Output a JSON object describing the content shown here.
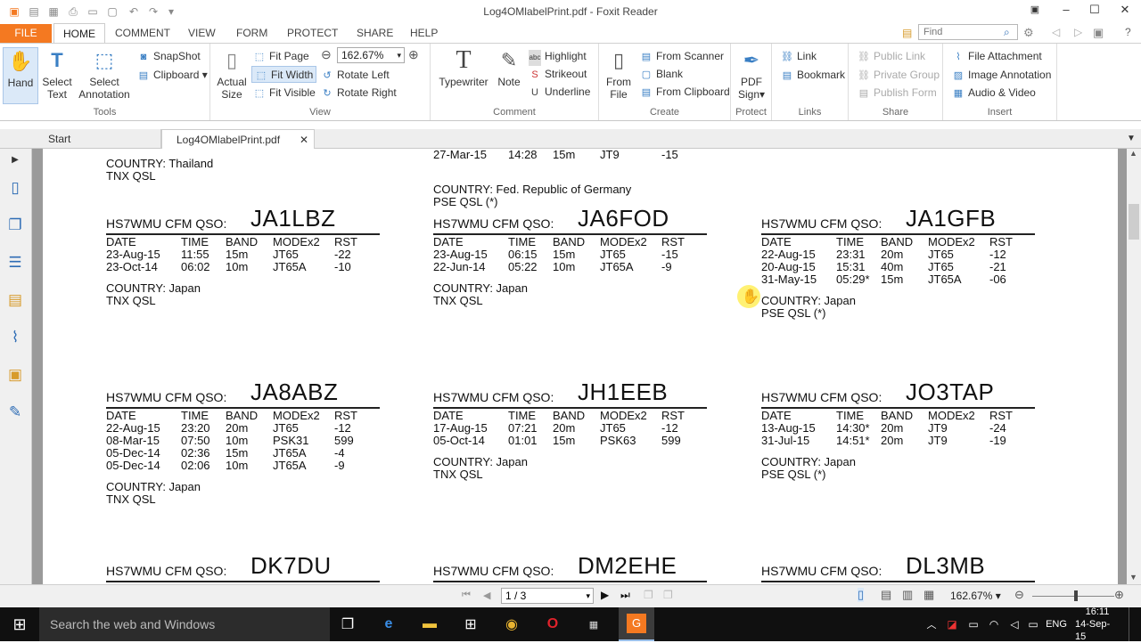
{
  "window": {
    "title": "Log4OMlabelPrint.pdf - Foxit Reader",
    "find_placeholder": "Find",
    "minimize_icon": "minimize-icon",
    "maximize_icon": "maximize-icon",
    "close_icon": "close-icon"
  },
  "menu_tabs": [
    "FILE",
    "HOME",
    "COMMENT",
    "VIEW",
    "FORM",
    "PROTECT",
    "SHARE",
    "HELP"
  ],
  "ribbon": {
    "tools": {
      "label": "Tools",
      "hand": "Hand",
      "select_text": [
        "Select",
        "Text"
      ],
      "select_annotation": [
        "Select",
        "Annotation"
      ],
      "snapshot": "SnapShot",
      "clipboard": "Clipboard"
    },
    "view": {
      "label": "View",
      "actual_size": [
        "Actual",
        "Size"
      ],
      "fit_page": "Fit Page",
      "fit_width": "Fit Width",
      "fit_visible": "Fit Visible",
      "zoom_value": "162.67%",
      "rotate_left": "Rotate Left",
      "rotate_right": "Rotate Right"
    },
    "comment": {
      "label": "Comment",
      "typewriter": "Typewriter",
      "note": "Note",
      "highlight": "Highlight",
      "strikeout": "Strikeout",
      "underline": "Underline"
    },
    "create": {
      "label": "Create",
      "from_file": [
        "From",
        "File"
      ],
      "from_scanner": "From Scanner",
      "blank": "Blank",
      "from_clipboard": "From Clipboard"
    },
    "protect": {
      "label": "Protect",
      "pdf_sign": [
        "PDF",
        "Sign"
      ]
    },
    "links": {
      "label": "Links",
      "link": "Link",
      "bookmark": "Bookmark"
    },
    "share": {
      "label": "Share",
      "public_link": "Public Link",
      "private_group": "Private Group",
      "publish_form": "Publish Form"
    },
    "insert": {
      "label": "Insert",
      "file_attachment": "File Attachment",
      "image_annotation": "Image Annotation",
      "audio_video": "Audio & Video"
    }
  },
  "doc_tabs": {
    "start": "Start",
    "file": "Log4OMlabelPrint.pdf"
  },
  "labels": {
    "cfm": "HS7WMU CFM QSO:",
    "headers": [
      "DATE",
      "TIME",
      "BAND",
      "MODEx2",
      "RST"
    ],
    "top_left": {
      "country": "COUNTRY: Thailand",
      "qsl": "TNX QSL"
    },
    "top_mid": {
      "row": [
        "27-Mar-15",
        "14:28",
        "15m",
        "JT9",
        "-15"
      ],
      "country": "COUNTRY: Fed. Republic of Germany",
      "qsl": "PSE QSL (*)"
    },
    "cards": [
      {
        "call": "JA1LBZ",
        "rows": [
          [
            "23-Aug-15",
            "11:55",
            "15m",
            "JT65",
            "-22"
          ],
          [
            "23-Oct-14",
            "06:02",
            "10m",
            "JT65A",
            "-10"
          ]
        ],
        "country": "COUNTRY: Japan",
        "qsl": "TNX QSL"
      },
      {
        "call": "JA6FOD",
        "rows": [
          [
            "23-Aug-15",
            "06:15",
            "15m",
            "JT65",
            "-15"
          ],
          [
            "22-Jun-14",
            "05:22",
            "10m",
            "JT65A",
            "-9"
          ]
        ],
        "country": "COUNTRY: Japan",
        "qsl": "TNX QSL"
      },
      {
        "call": "JA1GFB",
        "rows": [
          [
            "22-Aug-15",
            "23:31",
            "20m",
            "JT65",
            "-12"
          ],
          [
            "20-Aug-15",
            "15:31",
            "40m",
            "JT65",
            "-21"
          ],
          [
            "31-May-15",
            "05:29*",
            "15m",
            "JT65A",
            "-06"
          ]
        ],
        "country": "COUNTRY: Japan",
        "qsl": "PSE QSL (*)"
      },
      {
        "call": "JA8ABZ",
        "rows": [
          [
            "22-Aug-15",
            "23:20",
            "20m",
            "JT65",
            "-12"
          ],
          [
            "08-Mar-15",
            "07:50",
            "10m",
            "PSK31",
            "599"
          ],
          [
            "05-Dec-14",
            "02:36",
            "15m",
            "JT65A",
            "-4"
          ],
          [
            "05-Dec-14",
            "02:06",
            "10m",
            "JT65A",
            "-9"
          ]
        ],
        "country": "COUNTRY: Japan",
        "qsl": "TNX QSL"
      },
      {
        "call": "JH1EEB",
        "rows": [
          [
            "17-Aug-15",
            "07:21",
            "20m",
            "JT65",
            "-12"
          ],
          [
            "05-Oct-14",
            "01:01",
            "15m",
            "PSK63",
            "599"
          ]
        ],
        "country": "COUNTRY: Japan",
        "qsl": "TNX QSL"
      },
      {
        "call": "JO3TAP",
        "rows": [
          [
            "13-Aug-15",
            "14:30*",
            "20m",
            "JT9",
            "-24"
          ],
          [
            "31-Jul-15",
            "14:51*",
            "20m",
            "JT9",
            "-19"
          ]
        ],
        "country": "COUNTRY: Japan",
        "qsl": "PSE QSL (*)"
      },
      {
        "call": "DK7DU",
        "rows": [],
        "country": "",
        "qsl": ""
      },
      {
        "call": "DM2EHE",
        "rows": [],
        "country": "",
        "qsl": ""
      },
      {
        "call": "DL3MB",
        "rows": [],
        "country": "",
        "qsl": ""
      }
    ]
  },
  "statusbar": {
    "page": "1 / 3",
    "zoom": "162.67%"
  },
  "taskbar": {
    "search": "Search the web and Windows",
    "lang": "ENG",
    "time": "16:11",
    "date": "14-Sep-15"
  }
}
